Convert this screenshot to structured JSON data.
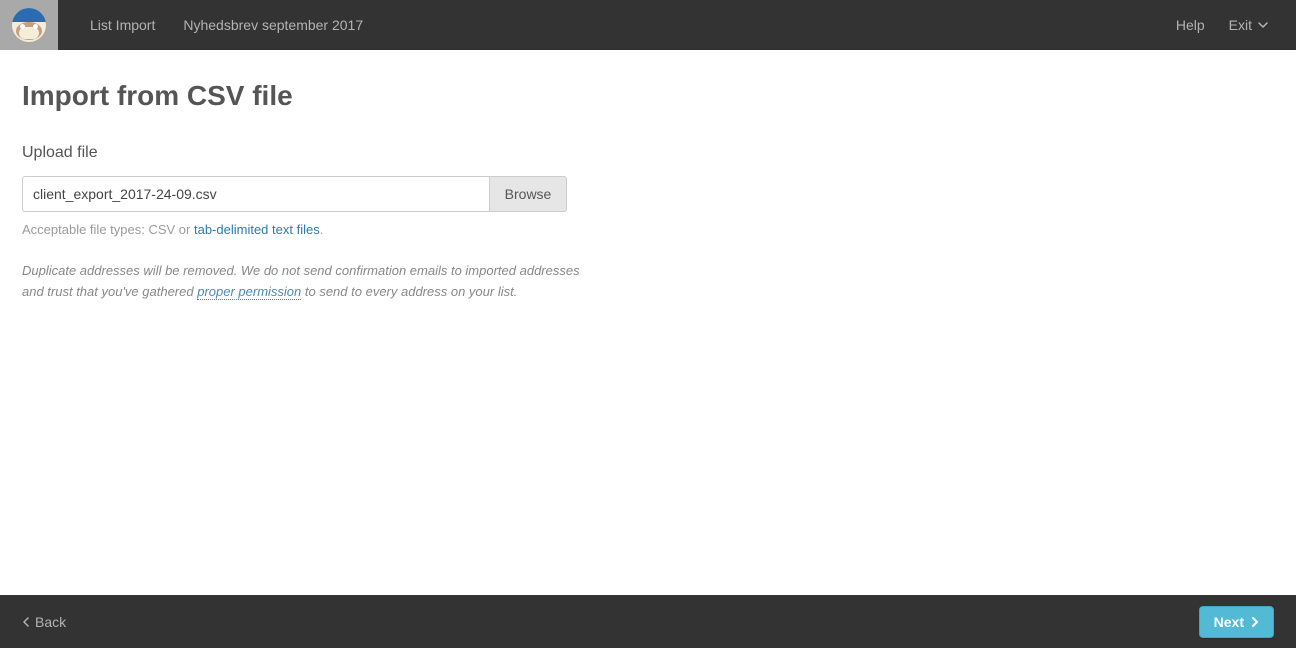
{
  "topbar": {
    "breadcrumb1": "List Import",
    "breadcrumb2": "Nyhedsbrev september 2017",
    "help": "Help",
    "exit": "Exit"
  },
  "page": {
    "title": "Import from CSV file",
    "upload_label": "Upload file",
    "file_value": "client_export_2017-24-09.csv",
    "browse_label": "Browse",
    "hint_prefix": "Acceptable file types: CSV or ",
    "hint_link": "tab-delimited text files",
    "hint_suffix": ".",
    "disclaimer_1": "Duplicate addresses will be removed. We do not send confirmation emails to imported addresses and trust that you've gathered ",
    "disclaimer_link": "proper permission",
    "disclaimer_2": " to send to every address on your list."
  },
  "footer": {
    "back": "Back",
    "next": "Next"
  }
}
